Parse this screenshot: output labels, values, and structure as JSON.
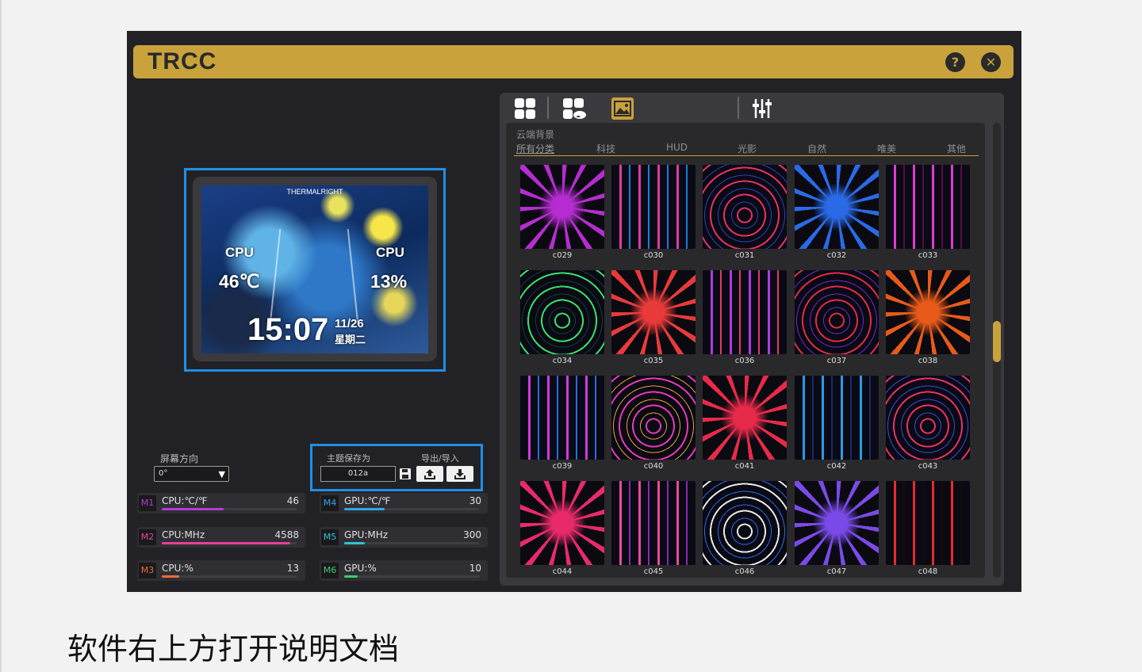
{
  "app": {
    "title": "TRCC",
    "help_icon": "?",
    "close_icon": "✕"
  },
  "preview": {
    "brand": "THERMALRIGHT",
    "cpu_label_1": "CPU",
    "cpu_temp": "46℃",
    "cpu_label_2": "CPU",
    "cpu_usage": "13%",
    "time": "15:07",
    "date": "11/26",
    "weekday": "星期二"
  },
  "orientation": {
    "label": "屏幕方向",
    "value": "0°"
  },
  "theme": {
    "save_label": "主题保存为",
    "export_label": "导出/导入",
    "name_value": "012a"
  },
  "monitors": [
    {
      "tag": "M1",
      "name": "CPU:℃/℉",
      "value": "46",
      "fill": 0.46,
      "color": "#b43cd6"
    },
    {
      "tag": "M2",
      "name": "CPU:MHz",
      "value": "4588",
      "fill": 0.95,
      "color": "#e8409a"
    },
    {
      "tag": "M3",
      "name": "CPU:%",
      "value": "13",
      "fill": 0.13,
      "color": "#ef6a3a"
    },
    {
      "tag": "M4",
      "name": "GPU:℃/℉",
      "value": "30",
      "fill": 0.3,
      "color": "#2fa6e8"
    },
    {
      "tag": "M5",
      "name": "GPU:MHz",
      "value": "300",
      "fill": 0.15,
      "color": "#34c0d8"
    },
    {
      "tag": "M6",
      "name": "GPU:%",
      "value": "10",
      "fill": 0.1,
      "color": "#3ccf6a"
    }
  ],
  "gallery": {
    "section_title": "云端背景",
    "categories": [
      "所有分类",
      "科技",
      "HUD",
      "光影",
      "自然",
      "唯美",
      "其他"
    ],
    "active_category": "所有分类",
    "toolbar_icons": [
      "grid-icon",
      "cloud-grid-icon",
      "image-icon",
      "sliders-icon"
    ],
    "items": [
      {
        "label": "c029",
        "colors": [
          "#b52cd0",
          "#3a0a5a"
        ]
      },
      {
        "label": "c030",
        "colors": [
          "#e03aa0",
          "#1a7ae0"
        ]
      },
      {
        "label": "c031",
        "colors": [
          "#e8306a",
          "#2a40c0"
        ]
      },
      {
        "label": "c032",
        "colors": [
          "#2a6ae8",
          "#e03a6a"
        ]
      },
      {
        "label": "c033",
        "colors": [
          "#e03ad0",
          "#5a0a4a"
        ]
      },
      {
        "label": "c034",
        "colors": [
          "#3ae06a",
          "#1a3a3a"
        ]
      },
      {
        "label": "c035",
        "colors": [
          "#e83a3a",
          "#3ae03a"
        ]
      },
      {
        "label": "c036",
        "colors": [
          "#b03ae0",
          "#e03a6a"
        ]
      },
      {
        "label": "c037",
        "colors": [
          "#e02a4a",
          "#6a2ad0"
        ]
      },
      {
        "label": "c038",
        "colors": [
          "#e85a1a",
          "#c01a1a"
        ]
      },
      {
        "label": "c039",
        "colors": [
          "#d03ae0",
          "#2a6ae0"
        ]
      },
      {
        "label": "c040",
        "colors": [
          "#e83ab0",
          "#e8a03a"
        ]
      },
      {
        "label": "c041",
        "colors": [
          "#e82a4a",
          "#a03ae0"
        ]
      },
      {
        "label": "c042",
        "colors": [
          "#2a9ae8",
          "#1a2a6a"
        ]
      },
      {
        "label": "c043",
        "colors": [
          "#e8306a",
          "#3a4ae0"
        ]
      },
      {
        "label": "c044",
        "colors": [
          "#e82a6a",
          "#6a1a3a"
        ]
      },
      {
        "label": "c045",
        "colors": [
          "#e84aa0",
          "#8a2ab0"
        ]
      },
      {
        "label": "c046",
        "colors": [
          "#e8e8e8",
          "#2a6ae8"
        ]
      },
      {
        "label": "c047",
        "colors": [
          "#7a4ae8",
          "#2a1a6a"
        ]
      },
      {
        "label": "c048",
        "colors": [
          "#e82a2a",
          "#1a0a0a"
        ]
      }
    ]
  },
  "caption": "软件右上方打开说明文档"
}
